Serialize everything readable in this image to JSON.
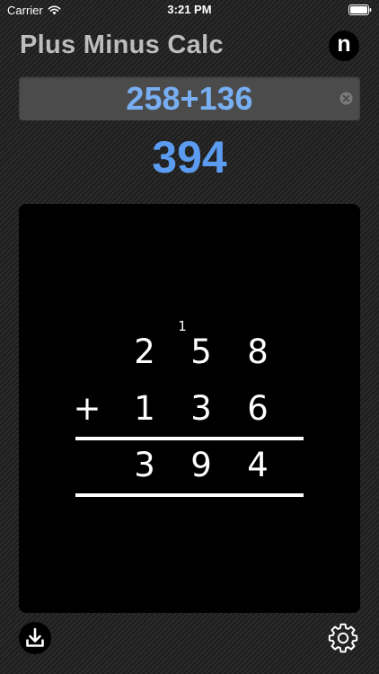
{
  "status_bar": {
    "carrier": "Carrier",
    "time": "3:21 PM"
  },
  "app": {
    "title": "Plus Minus Calc",
    "logo_letter": "n"
  },
  "expression": {
    "value": "258+136"
  },
  "result": "394",
  "work": {
    "operator": "+",
    "operand1": [
      "2",
      "5",
      "8"
    ],
    "operand2": [
      "1",
      "3",
      "6"
    ],
    "sum": [
      "3",
      "9",
      "4"
    ],
    "carry": "1"
  },
  "icons": {
    "wifi": "wifi-icon",
    "battery": "battery-icon",
    "clear": "clear-icon",
    "download": "download-icon",
    "settings": "gear-icon"
  },
  "colors": {
    "expression_text": "#78aef2",
    "result_text": "#5b9cf0",
    "title_text": "#bdbdbd"
  }
}
